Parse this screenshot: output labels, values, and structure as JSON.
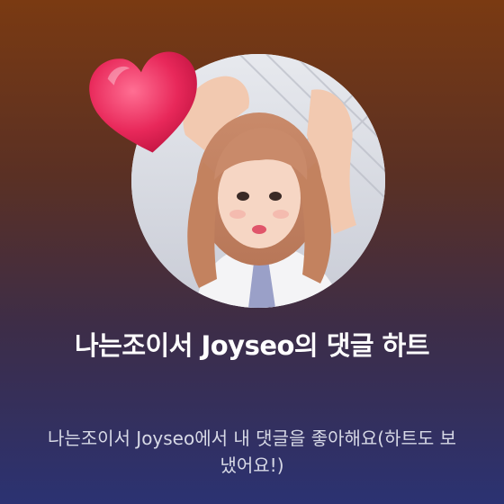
{
  "notification": {
    "title": "나는조이서 Joyseo의 댓글 하트",
    "message": "나는조이서 Joyseo에서 내 댓글을 좋아해요(하트도 보냈어요!)"
  },
  "colors": {
    "background_top": "#7a3a12",
    "background_bottom": "#2b3272",
    "heart": "#e8285a",
    "title_text": "#ffffff",
    "message_text": "#d7d9e6"
  },
  "icons": {
    "heart": "heart-icon"
  }
}
